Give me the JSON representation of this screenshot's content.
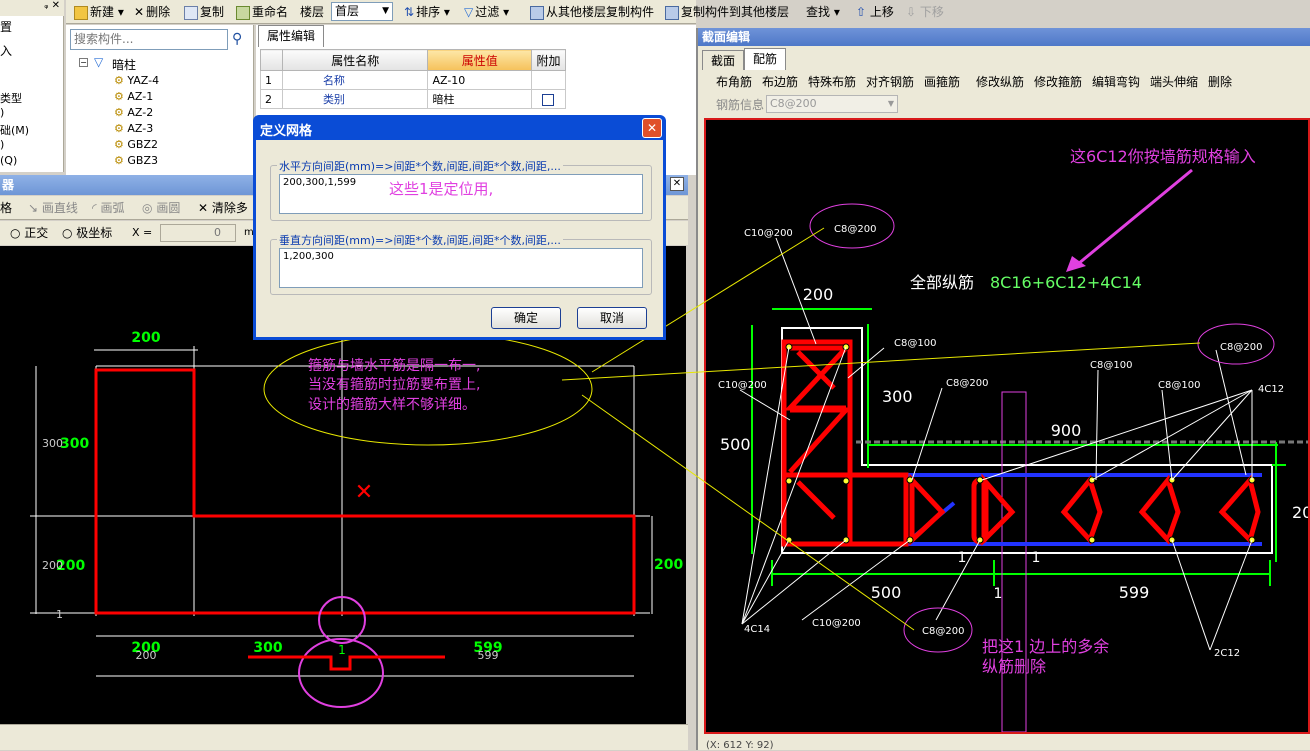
{
  "left_panel": {
    "list_items": [
      "置",
      "入",
      "",
      "类型",
      ")",
      "础(M)",
      ")",
      "(Q)"
    ]
  },
  "component_tree": {
    "search_placeholder": "搜索构件...",
    "root": "暗柱",
    "items": [
      "YAZ-4",
      "AZ-1",
      "AZ-2",
      "AZ-3",
      "GBZ2",
      "GBZ3"
    ]
  },
  "toolbar": {
    "new": "新建",
    "delete": "删除",
    "copy": "复制",
    "rename": "重命名",
    "floor_label": "楼层",
    "floor_value": "首层",
    "sort": "排序",
    "filter": "过滤",
    "copy_from_floor": "从其他楼层复制构件",
    "copy_to_floor": "复制构件到其他楼层",
    "find": "查找",
    "move_up": "上移",
    "move_down": "下移"
  },
  "property_panel": {
    "tab": "属性编辑",
    "headers": [
      "属性名称",
      "属性值",
      "附加"
    ],
    "rows": [
      {
        "no": "1",
        "name": "名称",
        "value": "AZ-10"
      },
      {
        "no": "2",
        "name": "类别",
        "value": "暗柱"
      }
    ]
  },
  "drawing_editor": {
    "title_fragment": "器",
    "tools": [
      "格",
      "画直线",
      "画弧",
      "画圆",
      "清除多"
    ],
    "ortho": "正交",
    "polar": "极坐标",
    "x_label": "X =",
    "x_value": "0",
    "unit_fragment": "m",
    "dims": {
      "top": "200",
      "left_upper": "300",
      "left_upper_ghost": "300",
      "left_lower": "200",
      "left_lower_ghost": "200",
      "left_tiny": "1",
      "right": "200",
      "bottom": [
        "200",
        "300",
        "1",
        "599"
      ],
      "bottom_ghost": [
        "200",
        "599"
      ]
    },
    "note": [
      "箍筋与墙水平筋是隔一布一,",
      "当没有箍筋时拉筋要布置上,",
      "设计的箍筋大样不够详细。"
    ]
  },
  "grid_dialog": {
    "title": "定义网格",
    "horizontal_label": "水平方向间距(mm)=>间距*个数,间距,间距*个数,间距,...",
    "horizontal_value": "200,300,1,599",
    "horizontal_note": "这些1是定位用,",
    "vertical_label": "垂直方向间距(mm)=>间距*个数,间距,间距*个数,间距,...",
    "vertical_value": "1,200,300",
    "ok": "确定",
    "cancel": "取消"
  },
  "section_editor": {
    "title": "截面编辑",
    "tabs": [
      "截面",
      "配筋"
    ],
    "rebar_tools": [
      "布角筋",
      "布边筋",
      "特殊布筋",
      "对齐钢筋",
      "画箍筋",
      "修改纵筋",
      "修改箍筋",
      "编辑弯钩",
      "端头伸缩",
      "删除"
    ],
    "rebar_info_label": "钢筋信息",
    "rebar_info_value": "C8@200",
    "status_fragment": "(X: 612 Y: 92)",
    "annotations": {
      "note_6c12": "这6C12你按墙筋规格输入",
      "all_longitudinal_prefix": "全部纵筋",
      "all_longitudinal_value": "8C16+6C12+4C14",
      "delete_note": [
        "把这1 边上的多余",
        "纵筋删除"
      ]
    },
    "labels": {
      "c10_200_a": "C10@200",
      "c8_200_a": "C8@200",
      "c8_100_a": "C8@100",
      "c10_200_b": "C10@200",
      "c8_200_b": "C8@200",
      "c8_100_b": "C8@100",
      "c8_100_c": "C8@100",
      "c8_200_c": "C8@200",
      "c12_4": "4C12",
      "c14_4": "4C14",
      "c10_200_c": "C10@200",
      "c8_200_d": "C8@200",
      "c12_2": "2C12"
    },
    "dims": {
      "top": "200",
      "v300": "300",
      "v500": "500",
      "h900": "900",
      "right_partial": "20",
      "b500": "500",
      "b1": "1",
      "b599": "599",
      "one_a": "1",
      "one_b": "1"
    }
  },
  "colors": {
    "cad_bg": "#000000",
    "wall": "#ff0000",
    "dim": "#00ff00",
    "magenta": "#e040e0",
    "title_bar": "#0a4cd6",
    "annotation_line": "#e8e800"
  }
}
